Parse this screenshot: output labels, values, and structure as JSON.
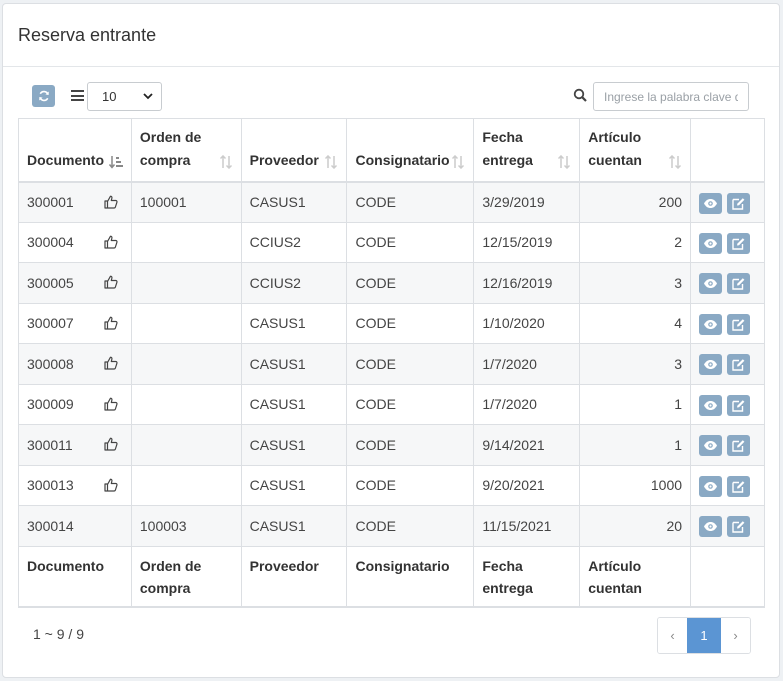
{
  "title": "Reserva entrante",
  "toolbar": {
    "page_size": "10",
    "search_placeholder": "Ingrese la palabra clave d"
  },
  "columns": [
    "Documento",
    "Orden de compra",
    "Proveedor",
    "Consignatario",
    "Fecha entrega",
    "Artículo cuentan"
  ],
  "footer_columns": [
    "Documento",
    "Orden de compra",
    "Proveedor",
    "Consignatario",
    "Fecha entrega",
    "Artículo cuentan"
  ],
  "rows": [
    {
      "doc": "300001",
      "po": "100001",
      "supplier": "CASUS1",
      "consignee": "CODE",
      "date": "3/29/2019",
      "count": "200",
      "thumb": true
    },
    {
      "doc": "300004",
      "po": "",
      "supplier": "CCIUS2",
      "consignee": "CODE",
      "date": "12/15/2019",
      "count": "2",
      "thumb": true
    },
    {
      "doc": "300005",
      "po": "",
      "supplier": "CCIUS2",
      "consignee": "CODE",
      "date": "12/16/2019",
      "count": "3",
      "thumb": true
    },
    {
      "doc": "300007",
      "po": "",
      "supplier": "CASUS1",
      "consignee": "CODE",
      "date": "1/10/2020",
      "count": "4",
      "thumb": true
    },
    {
      "doc": "300008",
      "po": "",
      "supplier": "CASUS1",
      "consignee": "CODE",
      "date": "1/7/2020",
      "count": "3",
      "thumb": true
    },
    {
      "doc": "300009",
      "po": "",
      "supplier": "CASUS1",
      "consignee": "CODE",
      "date": "1/7/2020",
      "count": "1",
      "thumb": true
    },
    {
      "doc": "300011",
      "po": "",
      "supplier": "CASUS1",
      "consignee": "CODE",
      "date": "9/14/2021",
      "count": "1",
      "thumb": true
    },
    {
      "doc": "300013",
      "po": "",
      "supplier": "CASUS1",
      "consignee": "CODE",
      "date": "9/20/2021",
      "count": "1000",
      "thumb": true
    },
    {
      "doc": "300014",
      "po": "100003",
      "supplier": "CASUS1",
      "consignee": "CODE",
      "date": "11/15/2021",
      "count": "20",
      "thumb": false
    }
  ],
  "pagination": {
    "summary": "1 ~ 9 / 9",
    "prev": "‹",
    "current": "1",
    "next": "›"
  },
  "colors": {
    "action_button": "#8aa9c4",
    "active_page": "#5b95d3"
  },
  "icons": [
    "refresh-icon",
    "list-icon",
    "search-icon",
    "sort-icon",
    "thumbs-up-icon",
    "eye-icon",
    "edit-icon"
  ]
}
